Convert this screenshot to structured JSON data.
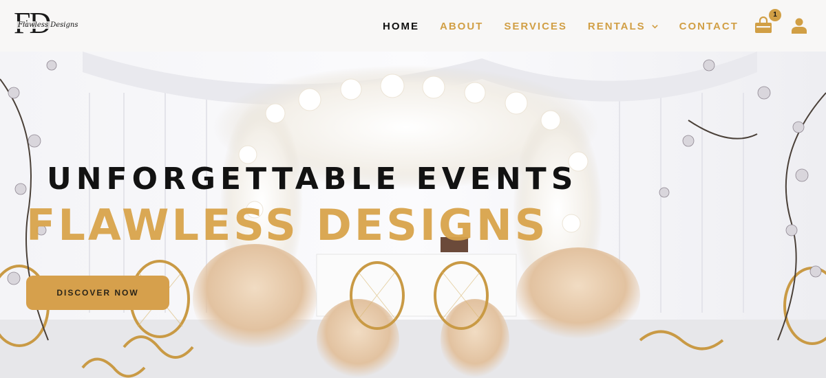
{
  "brand": {
    "monogram": "FD",
    "script": "Flawless Designs"
  },
  "nav": {
    "items": [
      {
        "label": "HOME",
        "active": true
      },
      {
        "label": "ABOUT"
      },
      {
        "label": "SERVICES"
      },
      {
        "label": "RENTALS",
        "has_dropdown": true
      },
      {
        "label": "CONTACT"
      }
    ]
  },
  "cart": {
    "icon": "shopping-bag-icon",
    "count": "1"
  },
  "account": {
    "icon": "user-icon"
  },
  "hero": {
    "title": "UNFORGETTABLE EVENTS",
    "brand": "FLAWLESS DESIGNS",
    "cta_label": "DISCOVER NOW"
  },
  "colors": {
    "accent": "#d19f45",
    "text": "#111111",
    "header_bg": "#f8f7f6"
  }
}
